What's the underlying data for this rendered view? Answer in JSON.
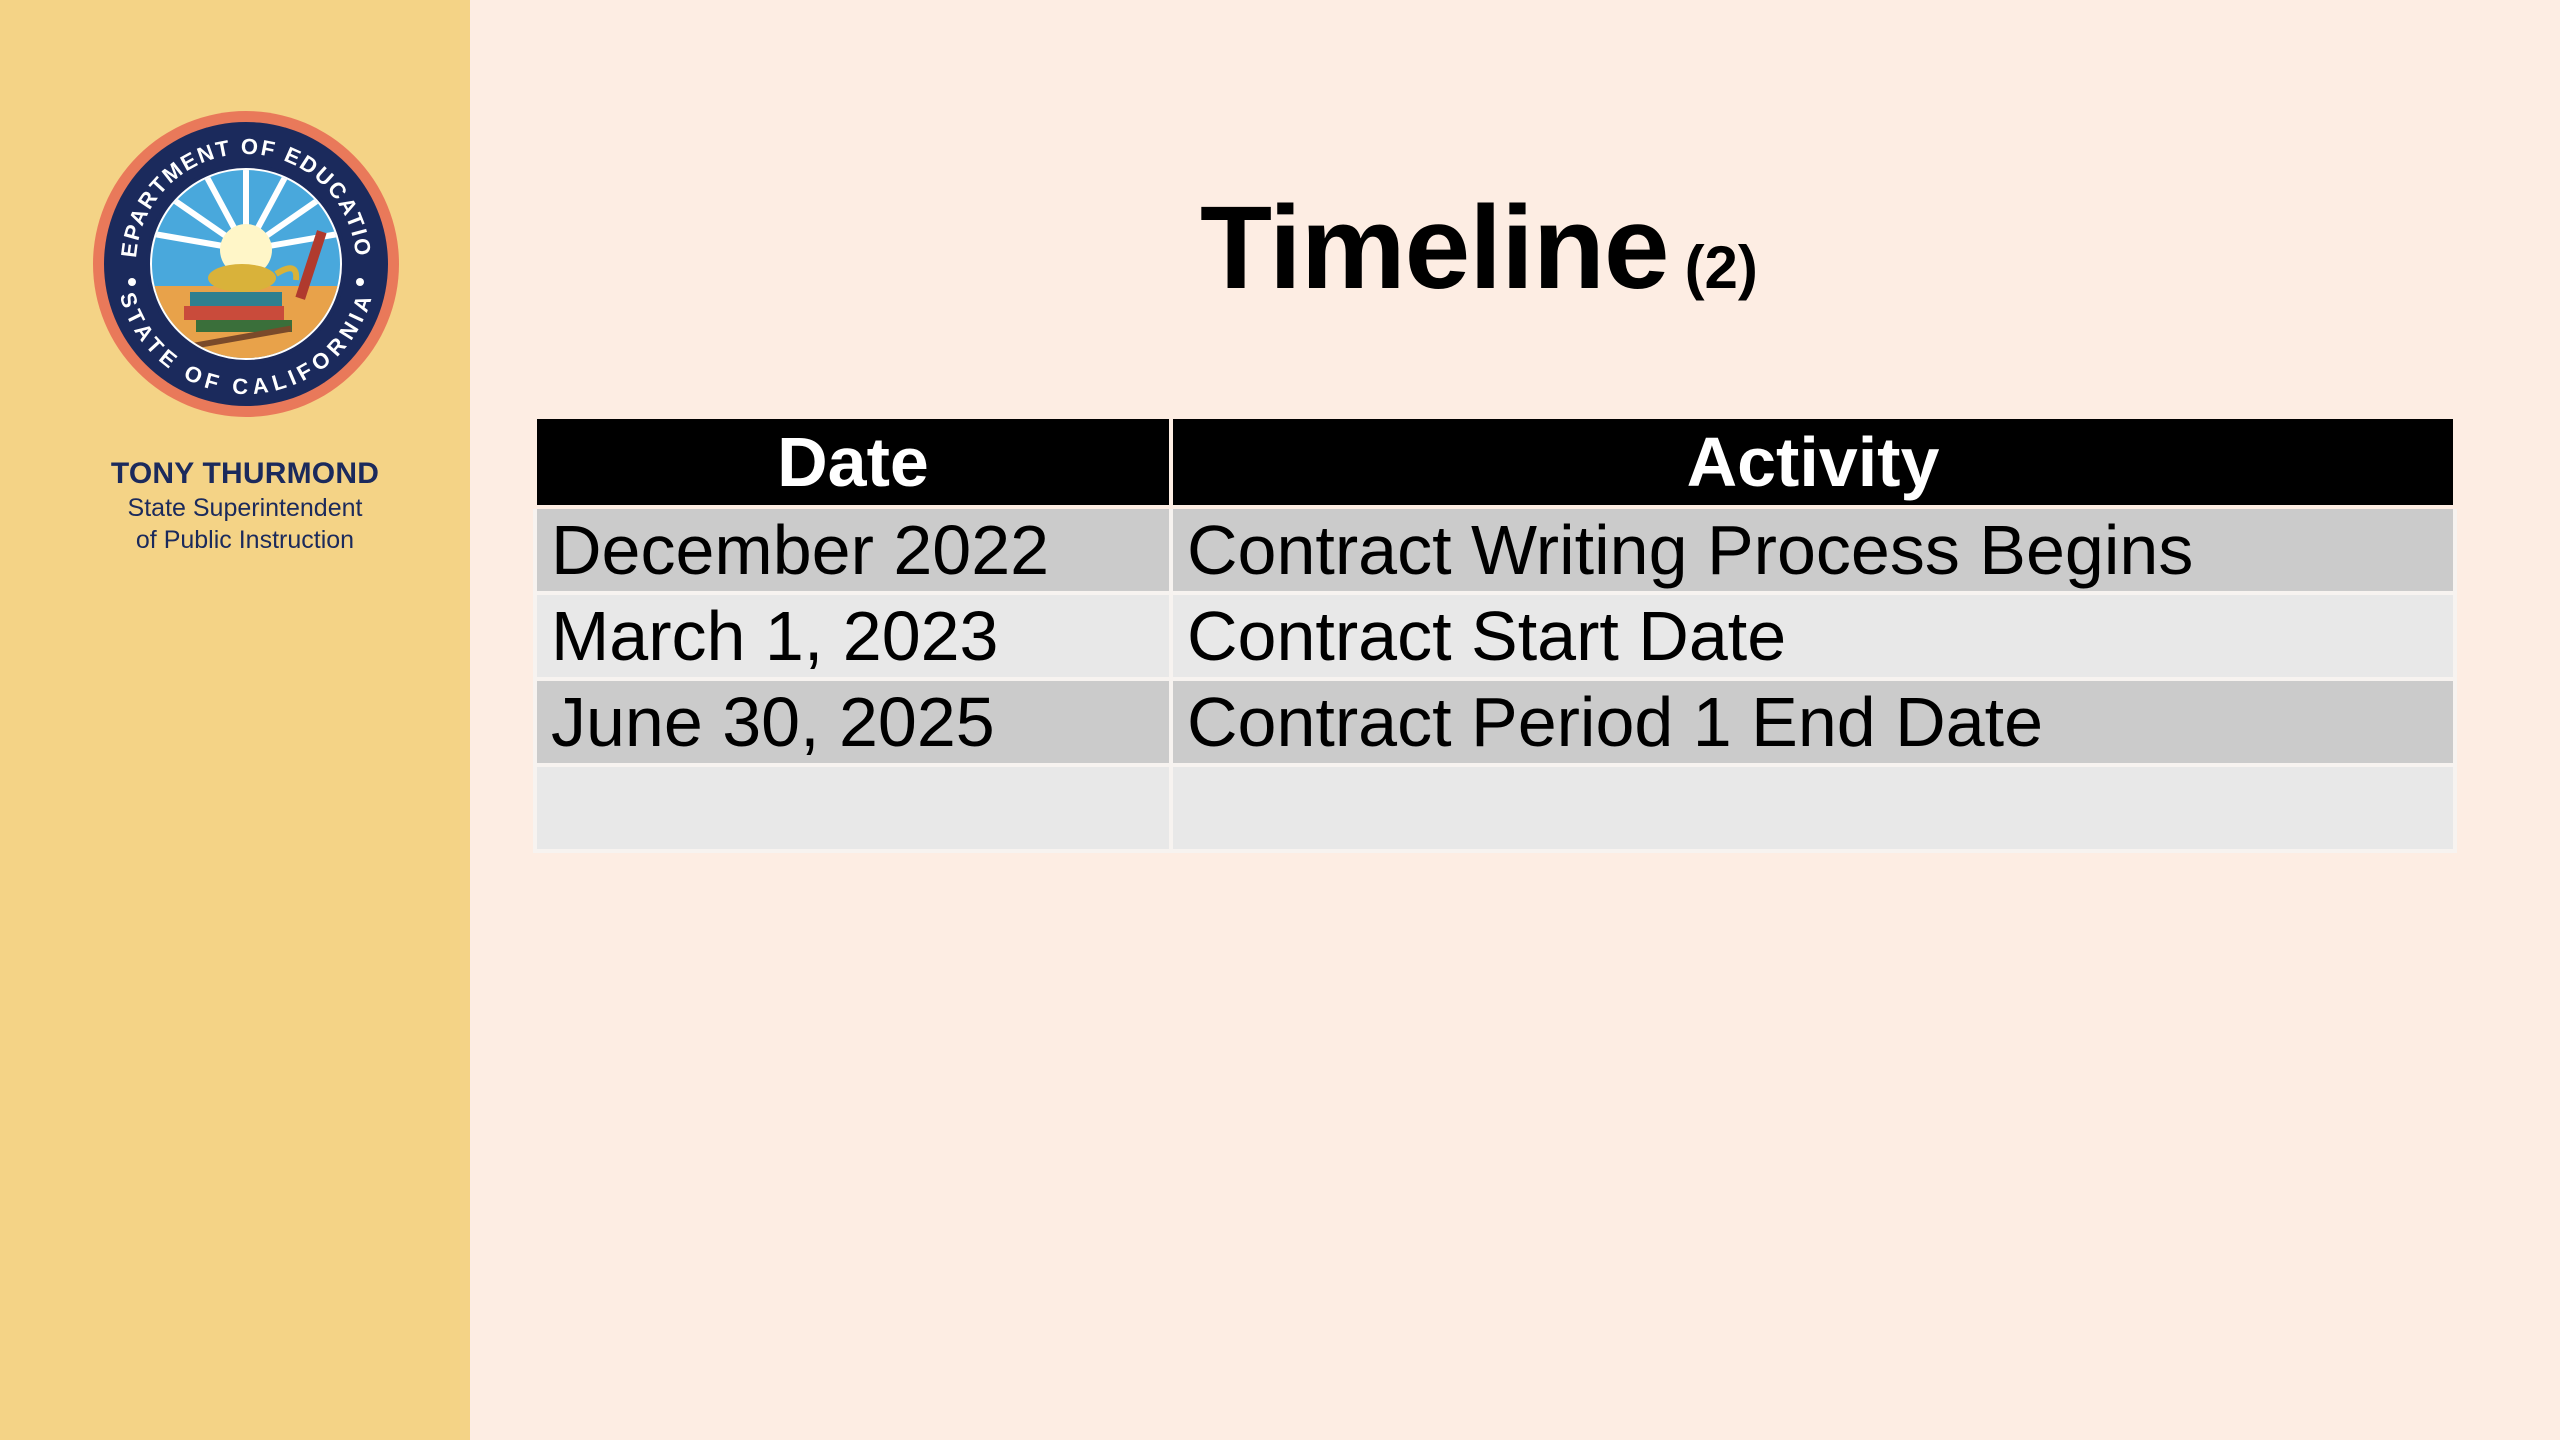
{
  "sidebar": {
    "seal": {
      "top_text": "DEPARTMENT OF EDUCATION",
      "bottom_text": "STATE OF CALIFORNIA",
      "ring_color": "#1b2a5c",
      "outer_color": "#e9795a"
    },
    "name": "TONY THURMOND",
    "role_line1": "State Superintendent",
    "role_line2": "of Public Instruction"
  },
  "slide": {
    "title": "Timeline",
    "title_suffix": "(2)"
  },
  "table": {
    "headers": [
      "Date",
      "Activity"
    ],
    "rows": [
      [
        "December 2022",
        "Contract Writing Process Begins"
      ],
      [
        "March 1, 2023",
        "Contract Start Date"
      ],
      [
        "June 30, 2025",
        "Contract Period 1 End Date"
      ],
      [
        "",
        ""
      ]
    ]
  },
  "colors": {
    "sidebar_bg": "#f4d386",
    "slide_bg": "#fdede3",
    "header_bg": "#000000",
    "row_dark": "#cbcbcb",
    "row_light": "#e8e8e8"
  }
}
